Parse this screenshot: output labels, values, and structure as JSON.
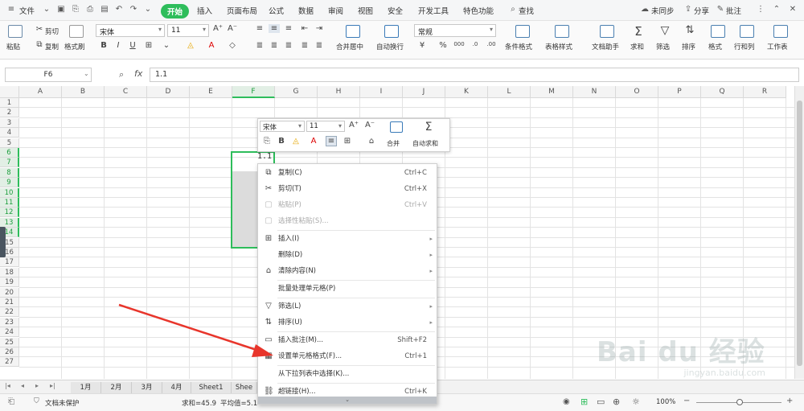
{
  "menubar": {
    "file": "文件",
    "tabs": [
      "开始",
      "插入",
      "页面布局",
      "公式",
      "数据",
      "审阅",
      "视图",
      "安全",
      "开发工具",
      "特色功能"
    ],
    "search": "查找",
    "sync": "未同步",
    "share": "分享",
    "comment": "批注"
  },
  "ribbon": {
    "paste": "粘贴",
    "cut": "剪切",
    "copy": "复制",
    "format_painter": "格式刷",
    "font_name": "宋体",
    "font_size": "11",
    "merge_center": "合并居中",
    "wrap_text": "自动换行",
    "number_format": "常规",
    "cond_format": "条件格式",
    "table_style": "表格样式",
    "doc_helper": "文档助手",
    "sum": "求和",
    "filter": "筛选",
    "sort": "排序",
    "format": "格式",
    "rows_cols": "行和列",
    "worksheet": "工作表"
  },
  "formula_bar": {
    "name_box": "F6",
    "fx": "fx",
    "value": "1.1"
  },
  "grid": {
    "columns": [
      "A",
      "B",
      "C",
      "D",
      "E",
      "F",
      "G",
      "H",
      "I",
      "J",
      "K",
      "L",
      "M",
      "N",
      "O",
      "P",
      "Q",
      "R"
    ],
    "rows": [
      "1",
      "2",
      "3",
      "4",
      "5",
      "6",
      "7",
      "8",
      "9",
      "10",
      "11",
      "12",
      "13",
      "14",
      "15",
      "16",
      "17",
      "18",
      "19",
      "20",
      "21",
      "22",
      "23",
      "24",
      "25",
      "26",
      "27"
    ],
    "cell_f6": "1.1"
  },
  "mini_toolbar": {
    "font_name": "宋体",
    "font_size": "11",
    "merge": "合并",
    "autosum": "自动求和",
    "bold": "B"
  },
  "context_menu": {
    "items": [
      {
        "label": "复制(C)",
        "shortcut": "Ctrl+C",
        "icon": "copy-icon"
      },
      {
        "label": "剪切(T)",
        "shortcut": "Ctrl+X",
        "icon": "scissors-icon"
      },
      {
        "label": "粘贴(P)",
        "shortcut": "Ctrl+V",
        "icon": "paste-icon"
      },
      {
        "label": "选择性粘贴(S)...",
        "shortcut": "",
        "icon": "paste-special-icon"
      },
      {
        "label": "插入(I)",
        "shortcut": "",
        "icon": "insert-icon"
      },
      {
        "label": "删除(D)",
        "shortcut": "",
        "icon": ""
      },
      {
        "label": "清除内容(N)",
        "shortcut": "",
        "icon": "eraser-icon"
      },
      {
        "label": "批量处理单元格(P)",
        "shortcut": "",
        "icon": ""
      },
      {
        "label": "筛选(L)",
        "shortcut": "",
        "icon": "filter-icon"
      },
      {
        "label": "排序(U)",
        "shortcut": "",
        "icon": "sort-icon"
      },
      {
        "label": "插入批注(M)...",
        "shortcut": "Shift+F2",
        "icon": "comment-icon"
      },
      {
        "label": "设置单元格格式(F)...",
        "shortcut": "Ctrl+1",
        "icon": "format-cells-icon"
      },
      {
        "label": "从下拉列表中选择(K)...",
        "shortcut": "",
        "icon": ""
      },
      {
        "label": "超链接(H)...",
        "shortcut": "Ctrl+K",
        "icon": "link-icon"
      }
    ]
  },
  "sheets": [
    "1月",
    "2月",
    "3月",
    "4月",
    "Sheet1",
    "Shee"
  ],
  "status": {
    "doc_protect": "文档未保护",
    "sum": "求和=45.9",
    "avg": "平均值=5.1",
    "zoom": "100%"
  },
  "watermark": {
    "brand": "Bai du 经验",
    "url": "jingyan.baidu.com"
  },
  "colors": {
    "accent": "#2ebd5b",
    "selection": "#1e9e3e",
    "arrow": "#e8352b"
  }
}
